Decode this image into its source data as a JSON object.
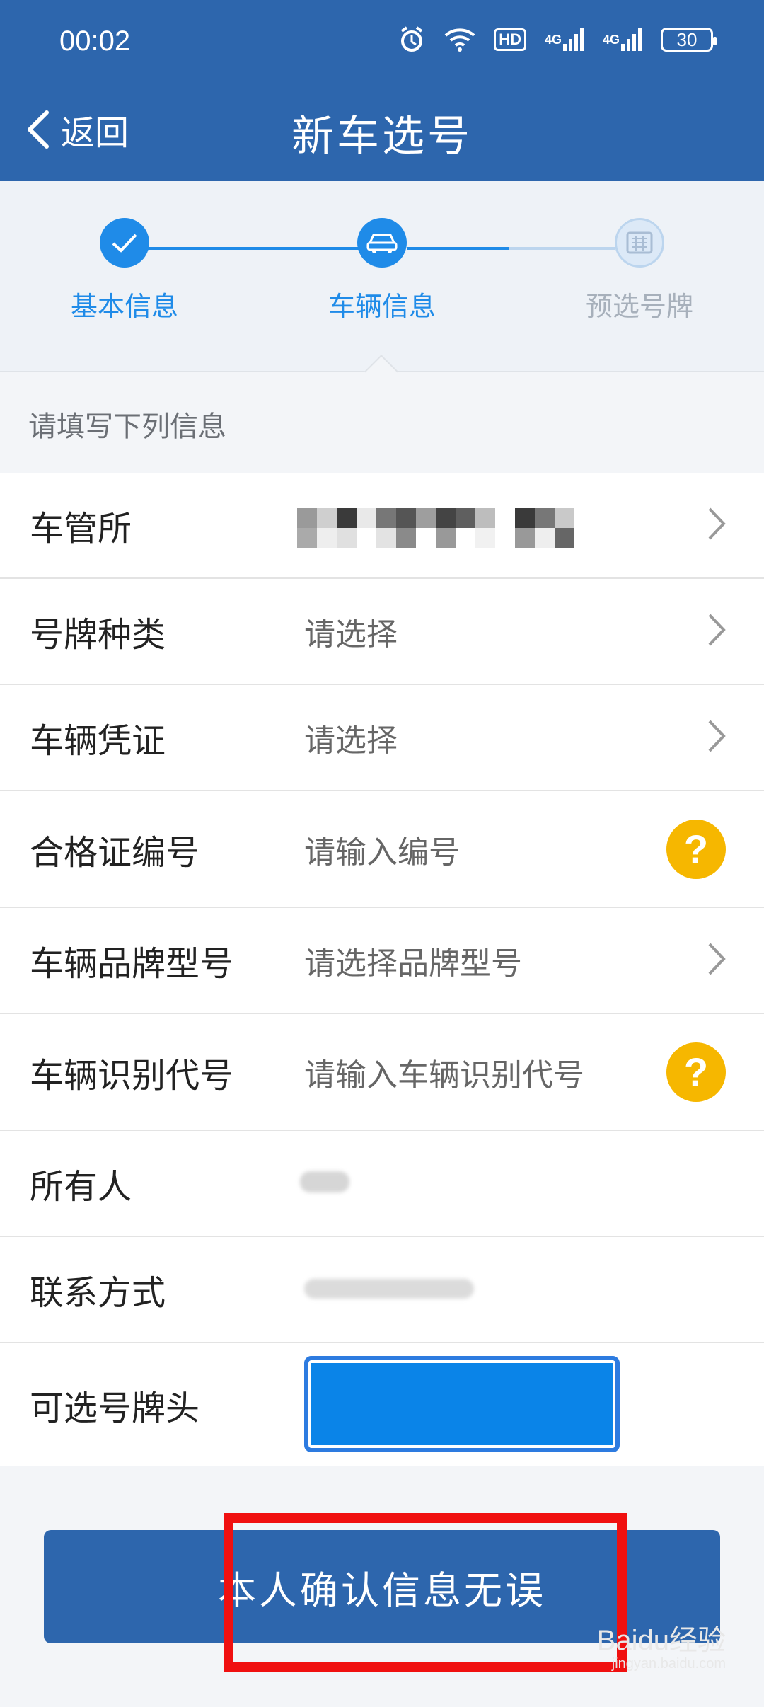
{
  "status_bar": {
    "time": "00:02",
    "network_hd": "HD",
    "network_4g_1": "4G",
    "network_4g_2": "4G",
    "battery": "30"
  },
  "header": {
    "back_label": "返回",
    "title": "新车选号"
  },
  "steps": [
    {
      "label": "基本信息",
      "state": "done"
    },
    {
      "label": "车辆信息",
      "state": "current"
    },
    {
      "label": "预选号牌",
      "state": "pending"
    }
  ],
  "section_hint": "请填写下列信息",
  "form": {
    "rows": [
      {
        "label": "车管所",
        "value": ""
      },
      {
        "label": "号牌种类",
        "value": "请选择"
      },
      {
        "label": "车辆凭证",
        "value": "请选择"
      },
      {
        "label": "合格证编号",
        "placeholder": "请输入编号"
      },
      {
        "label": "车辆品牌型号",
        "value": "请选择品牌型号"
      },
      {
        "label": "车辆识别代号",
        "placeholder": "请输入车辆识别代号"
      },
      {
        "label": "所有人",
        "value": ""
      },
      {
        "label": "联系方式",
        "value": ""
      },
      {
        "label": "可选号牌头",
        "value": ""
      }
    ]
  },
  "confirm_button": "本人确认信息无误",
  "watermark": {
    "brand": "Baidu经验",
    "sub": "jingyan.baidu.com"
  },
  "colors": {
    "primary": "#2d66ad",
    "step_active": "#1f8be8",
    "help": "#f6b700",
    "highlight_box": "#f01010"
  }
}
